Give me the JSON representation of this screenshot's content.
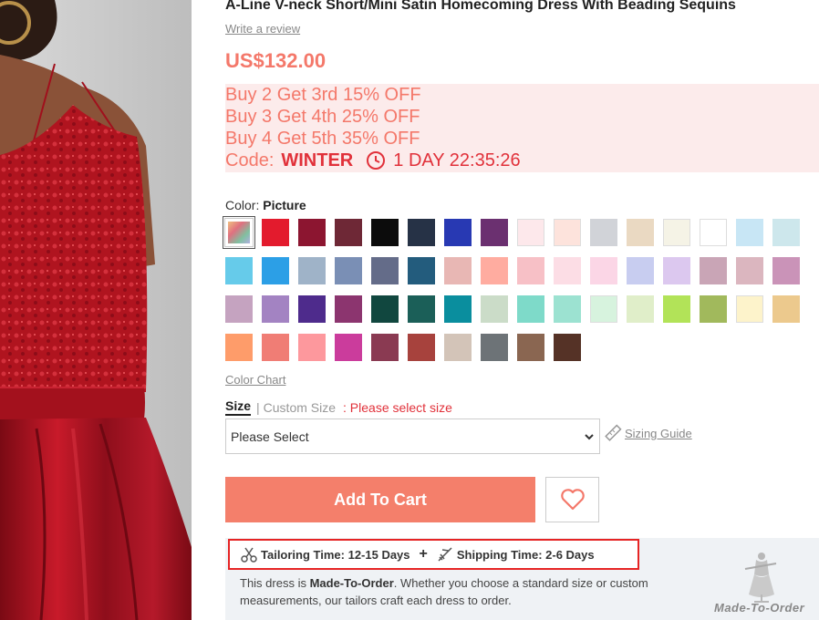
{
  "product": {
    "title": "A-Line V-neck Short/Mini Satin Homecoming Dress With Beading Sequins",
    "write_review": "Write a review",
    "price": "US$132.00"
  },
  "promo": {
    "lines": [
      "Buy 2 Get 3rd 15% OFF",
      "Buy 3 Get 4th 25% OFF",
      "Buy 4 Get 5th 35% OFF"
    ],
    "code_label": "Code:",
    "code": "WINTER",
    "countdown": "1 DAY 22:35:26",
    "bg_color": "#fcebeb",
    "text_color": "#f4786a",
    "code_color": "#e1313a"
  },
  "color": {
    "label": "Color:",
    "selected": "Picture",
    "chart_link": "Color Chart",
    "swatches": [
      "picture",
      "#e31b2d",
      "#8c1530",
      "#6e2836",
      "#0c0c0c",
      "#263246",
      "#2839b3",
      "#6b3070",
      "#fde8eb",
      "#fde3dc",
      "#d1d3d8",
      "#ead9c2",
      "#f5f3e6",
      "#ffffff",
      "#c8e6f5",
      "#cde7ec",
      "#66cbea",
      "#2c9fe6",
      "#9fb3c8",
      "#7a8fb5",
      "#646c89",
      "#235c7d",
      "#e8b7b4",
      "#ffaca0",
      "#f7c0c6",
      "#fcdde5",
      "#fbd6e6",
      "#c8cdf0",
      "#dcc8ef",
      "#c9a5b6",
      "#dbb6bf",
      "#ca93b8",
      "#c5a3c0",
      "#a383c2",
      "#4e2b8c",
      "#8c356f",
      "#11473f",
      "#1b5f58",
      "#0a8e9e",
      "#cbdcc8",
      "#7edac9",
      "#9ce2d1",
      "#d7f3de",
      "#e0eec9",
      "#b2e358",
      "#a1b95c",
      "#fdf3cb",
      "#ecc98d",
      "#fe9c6a",
      "#f07d75",
      "#fd989d",
      "#cb3c9c",
      "#8a3a52",
      "#a7423d",
      "#d3c4b8",
      "#6d7377",
      "#8a6651",
      "#553226"
    ]
  },
  "size": {
    "tab_size": "Size",
    "separator": "|",
    "tab_custom": "Custom Size",
    "warning": ": Please select size",
    "select_value": "Please Select",
    "sizing_guide": "Sizing Guide"
  },
  "actions": {
    "add_to_cart": "Add To Cart",
    "add_color": "#f47f6b"
  },
  "made_to_order": {
    "tailoring": "Tailoring Time: 12-15 Days",
    "plus": "+",
    "shipping": "Shipping Time: 2-6 Days",
    "desc_prefix": "This dress is ",
    "desc_bold": "Made-To-Order",
    "desc_suffix": ". Whether you choose a standard size or custom measurements, our tailors craft each dress to order.",
    "logo_text": "Made-To-Order"
  }
}
